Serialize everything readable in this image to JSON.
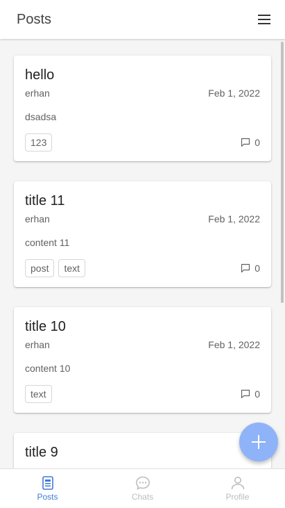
{
  "appbar": {
    "title": "Posts",
    "menu_icon": "menu-icon"
  },
  "posts": [
    {
      "title": "hello",
      "author": "erhan",
      "date": "Feb 1, 2022",
      "content": "dsadsa",
      "tags": [
        "123"
      ],
      "comments": "0"
    },
    {
      "title": "title 11",
      "author": "erhan",
      "date": "Feb 1, 2022",
      "content": "content 11",
      "tags": [
        "post",
        "text"
      ],
      "comments": "0"
    },
    {
      "title": "title 10",
      "author": "erhan",
      "date": "Feb 1, 2022",
      "content": "content 10",
      "tags": [
        "text"
      ],
      "comments": "0"
    },
    {
      "title": "title 9"
    }
  ],
  "fab": {
    "icon": "plus-icon"
  },
  "bottom_nav": {
    "items": [
      {
        "label": "Posts",
        "icon": "posts-icon",
        "active": true
      },
      {
        "label": "Chats",
        "icon": "chat-icon",
        "active": false
      },
      {
        "label": "Profile",
        "icon": "person-icon",
        "active": false
      }
    ]
  },
  "colors": {
    "accent": "#3f7ad8",
    "fab": "#8fb3f8",
    "inactive": "#bdbdbd"
  }
}
